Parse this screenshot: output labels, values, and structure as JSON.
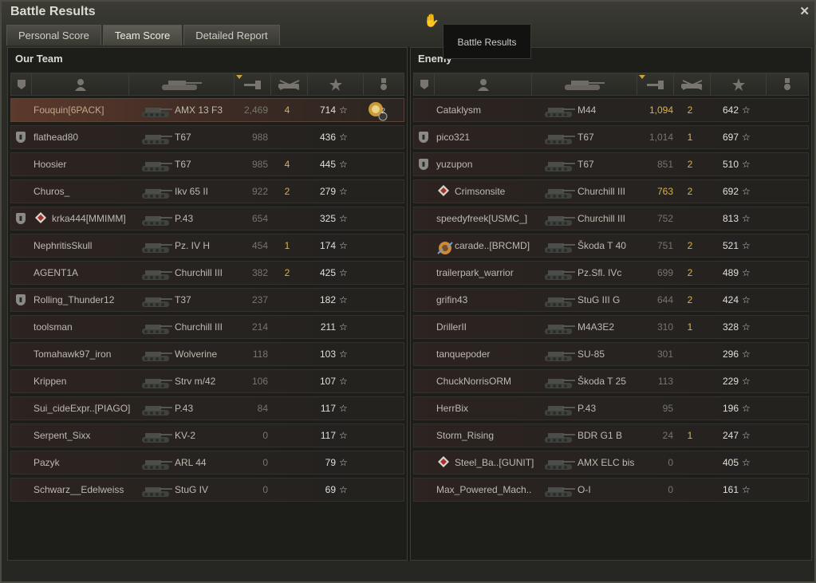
{
  "window": {
    "title": "Battle Results",
    "tooltip": "Battle Results",
    "close_icon": "close-icon",
    "cursor_icon": "hand-cursor-icon"
  },
  "tabs": [
    {
      "label": "Personal Score",
      "active": false
    },
    {
      "label": "Team Score",
      "active": true
    },
    {
      "label": "Detailed Report",
      "active": false
    }
  ],
  "colors": {
    "gold": "#d9b24a",
    "highlight_row": "#5c3a2c",
    "text": "#bdbab0"
  },
  "columns": [
    "platoon-icon",
    "player-icon",
    "tank-icon",
    "damage-icon",
    "kills-icon",
    "xp-star-icon",
    "medal-icon"
  ],
  "our_team": {
    "title": "Our Team",
    "rows": [
      {
        "player": "Fouquin[6PACK]",
        "tank": "AMX 13 F3",
        "damage": "2,469",
        "kills": "4",
        "xp": "714",
        "me": true,
        "platoon": false,
        "rank_icon": false,
        "medal": true,
        "medal_count": "2"
      },
      {
        "player": "flathead80",
        "tank": "T67",
        "damage": "988",
        "kills": "",
        "xp": "436",
        "platoon": true
      },
      {
        "player": "Hoosier",
        "tank": "T67",
        "damage": "985",
        "kills": "4",
        "xp": "445"
      },
      {
        "player": "Churos_",
        "tank": "Ikv 65 II",
        "damage": "922",
        "kills": "2",
        "xp": "279"
      },
      {
        "player": "krka444[MMIMM]",
        "tank": "P.43",
        "damage": "654",
        "kills": "",
        "xp": "325",
        "platoon": true,
        "rank_icon": true
      },
      {
        "player": "NephritisSkull",
        "tank": "Pz. IV H",
        "damage": "454",
        "kills": "1",
        "xp": "174"
      },
      {
        "player": "AGENT1A",
        "tank": "Churchill III",
        "damage": "382",
        "kills": "2",
        "xp": "425"
      },
      {
        "player": "Rolling_Thunder12",
        "tank": "T37",
        "damage": "237",
        "kills": "",
        "xp": "182",
        "platoon": true
      },
      {
        "player": "toolsman",
        "tank": "Churchill III",
        "damage": "214",
        "kills": "",
        "xp": "211"
      },
      {
        "player": "Tomahawk97_iron",
        "tank": "Wolverine",
        "damage": "118",
        "kills": "",
        "xp": "103"
      },
      {
        "player": "Krippen",
        "tank": "Strv m/42",
        "damage": "106",
        "kills": "",
        "xp": "107"
      },
      {
        "player": "Sui_cideExpr..[PIAGO]",
        "tank": "P.43",
        "damage": "84",
        "kills": "",
        "xp": "117"
      },
      {
        "player": "Serpent_Sixx",
        "tank": "KV-2",
        "damage": "0",
        "kills": "",
        "xp": "117"
      },
      {
        "player": "Pazyk",
        "tank": "ARL 44",
        "damage": "0",
        "kills": "",
        "xp": "79"
      },
      {
        "player": "Schwarz__Edelweiss",
        "tank": "StuG IV",
        "damage": "0",
        "kills": "",
        "xp": "69"
      }
    ]
  },
  "enemy_team": {
    "title": "Enemy",
    "rows": [
      {
        "player": "Cataklysm",
        "tank": "M44",
        "damage": "1,094",
        "kills": "2",
        "xp": "642",
        "dmg_hi": true
      },
      {
        "player": "pico321",
        "tank": "T67",
        "damage": "1,014",
        "kills": "1",
        "xp": "697",
        "platoon": true
      },
      {
        "player": "yuzupon",
        "tank": "T67",
        "damage": "851",
        "kills": "2",
        "xp": "510",
        "platoon": true
      },
      {
        "player": "Crimsonsite",
        "tank": "Churchill III",
        "damage": "763",
        "kills": "2",
        "xp": "692",
        "rank_icon": true,
        "dmg_hi": true
      },
      {
        "player": "speedyfreek[USMC_]",
        "tank": "Churchill III",
        "damage": "752",
        "kills": "",
        "xp": "813"
      },
      {
        "player": "carade..[BRCMD]",
        "tank": "Škoda T 40",
        "damage": "751",
        "kills": "2",
        "xp": "521",
        "clan_icon": true
      },
      {
        "player": "trailerpark_warrior",
        "tank": "Pz.Sfl. IVc",
        "damage": "699",
        "kills": "2",
        "xp": "489"
      },
      {
        "player": "grifin43",
        "tank": "StuG III G",
        "damage": "644",
        "kills": "2",
        "xp": "424"
      },
      {
        "player": "DrillerII",
        "tank": "M4A3E2",
        "damage": "310",
        "kills": "1",
        "xp": "328"
      },
      {
        "player": "tanquepoder",
        "tank": "SU-85",
        "damage": "301",
        "kills": "",
        "xp": "296"
      },
      {
        "player": "ChuckNorrisORM",
        "tank": "Škoda T 25",
        "damage": "113",
        "kills": "",
        "xp": "229"
      },
      {
        "player": "HerrBix",
        "tank": "P.43",
        "damage": "95",
        "kills": "",
        "xp": "196"
      },
      {
        "player": "Storm_Rising",
        "tank": "BDR G1 B",
        "damage": "24",
        "kills": "1",
        "xp": "247"
      },
      {
        "player": "Steel_Ba..[GUNIT]",
        "tank": "AMX ELC bis",
        "damage": "0",
        "kills": "",
        "xp": "405",
        "rank_icon": true
      },
      {
        "player": "Max_Powered_Mach..",
        "tank": "O-I",
        "damage": "0",
        "kills": "",
        "xp": "161"
      }
    ]
  }
}
